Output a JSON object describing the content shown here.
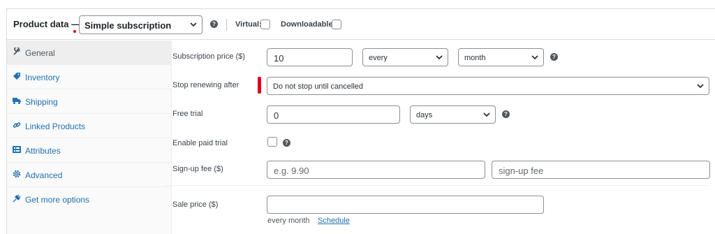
{
  "header": {
    "title": "Product data —",
    "product_type": "Simple subscription",
    "virtual_label": "Virtual:",
    "downloadable_label": "Downloadable:"
  },
  "sidebar": {
    "items": [
      {
        "label": "General",
        "icon": "wrench-icon",
        "active": true
      },
      {
        "label": "Inventory",
        "icon": "tag-icon"
      },
      {
        "label": "Shipping",
        "icon": "truck-icon"
      },
      {
        "label": "Linked Products",
        "icon": "link-icon"
      },
      {
        "label": "Attributes",
        "icon": "list-icon"
      },
      {
        "label": "Advanced",
        "icon": "gear-icon"
      },
      {
        "label": "Get more options",
        "icon": "plugin-icon"
      }
    ]
  },
  "fields": {
    "subscription_price": {
      "label": "Subscription price ($)",
      "value": "10",
      "period": "every",
      "interval": "month"
    },
    "stop_renewing": {
      "label": "Stop renewing after",
      "value": "Do not stop until cancelled"
    },
    "free_trial": {
      "label": "Free trial",
      "value": "0",
      "unit": "days"
    },
    "paid_trial": {
      "label": "Enable paid trial"
    },
    "signup_fee": {
      "label": "Sign-up fee ($)",
      "placeholder": "e.g. 9.90",
      "period_placeholder": "sign-up fee"
    },
    "sale_price": {
      "label": "Sale price ($)",
      "value": "",
      "description": "every month",
      "schedule_link": "Schedule"
    }
  },
  "colors": {
    "link": "#2271b1",
    "accent_red": "#e0001b"
  }
}
